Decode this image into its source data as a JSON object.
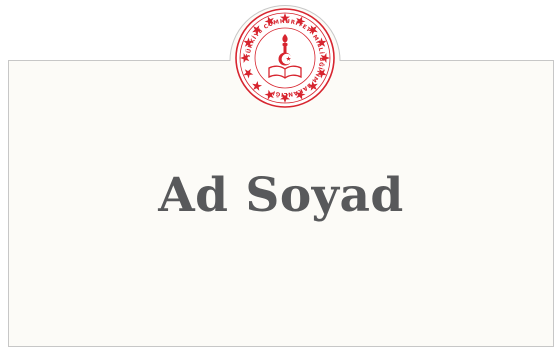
{
  "card": {
    "name_text": "Ad Soyad"
  },
  "emblem": {
    "ring_text": "TÜRKİYE CUMHURİYETİ MİLLİ EĞİTİM BAKANLIĞI",
    "color": "#d7252f"
  },
  "colors": {
    "card_background": "#fcfbf7",
    "card_border": "#c7c7c7",
    "name_text": "#58595b",
    "emblem_red": "#d7252f"
  }
}
